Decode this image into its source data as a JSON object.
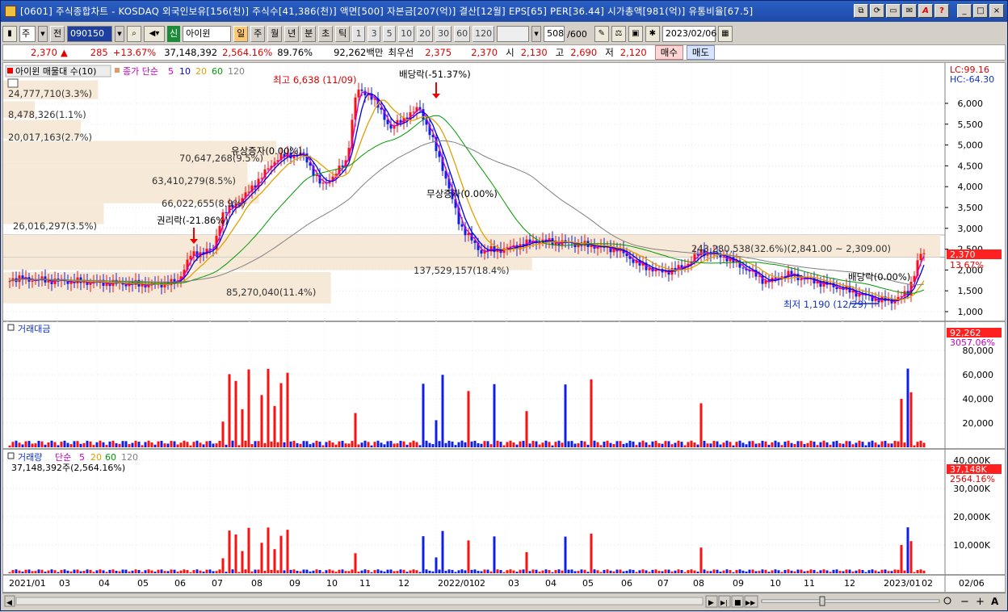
{
  "window": {
    "title": "[0601] 주식종합차트 - KOSDAQ 외국인보유[156(천)] 주식수[41,386(천)] 액면[500] 자본금[207(억)] 결산[12월] EPS[65] PER[36.44] 시가총액[981(억)] 유통비율[67.5]",
    "controls": [
      "⧉",
      "⟳",
      "▭",
      "✉",
      "A",
      "?",
      "_",
      "□",
      "×"
    ]
  },
  "toolbar": {
    "period_type": "주",
    "prev_label": "전",
    "stock_code": "090150",
    "new_tag": "신",
    "stock_name": "아이윈",
    "intervals": [
      "일",
      "주",
      "월",
      "년",
      "분",
      "초",
      "틱"
    ],
    "minute_options": [
      "1",
      "3",
      "5",
      "10",
      "20",
      "30",
      "60",
      "120"
    ],
    "count_value": "508",
    "count_total": "/600",
    "date": "2023/02/06"
  },
  "infobar": {
    "price": "2,370",
    "change_arrow": "▲",
    "change": "285",
    "change_pct": "+13.67%",
    "volume": "37,148,392",
    "volume_pct": "2,564.16%",
    "ratio": "89.76%",
    "amount": "92,262백만",
    "best_label": "최우선",
    "best_ask": "2,375",
    "best_bid": "2,370",
    "open_label": "시",
    "open": "2,130",
    "high_label": "고",
    "high": "2,690",
    "low_label": "저",
    "low": "2,120",
    "buy_label": "매수",
    "sell_label": "매도"
  },
  "price_panel": {
    "legend_stock": "아이윈 매물대 수(10)",
    "legend_ma": "종가 단순",
    "ma_periods": [
      "5",
      "10",
      "20",
      "60",
      "120"
    ],
    "ma_colors": {
      "5": "#cc00cc",
      "10": "#0000dd",
      "20": "#e0a000",
      "60": "#009900",
      "120": "#808080"
    },
    "lc": "LC:99.16",
    "hc": "HC:-64.30",
    "price_axis": [
      "6,000",
      "5,500",
      "5,000",
      "4,500",
      "4,000",
      "3,500",
      "3,000",
      "2,500",
      "2,000",
      "1,500",
      "1,000"
    ],
    "current_price_tag": "2,370",
    "current_pct_tag": "13.67%",
    "volume_profile": [
      {
        "label": "24,777,710(3.3%)",
        "share": 3.3
      },
      {
        "label": "8,478,326(1.1%)",
        "share": 1.1
      },
      {
        "label": "20,017,163(2.7%)",
        "share": 2.7
      },
      {
        "label": "70,647,268(9.5%)",
        "share": 9.5
      },
      {
        "label": "63,410,279(8.5%)",
        "share": 8.5
      },
      {
        "label": "66,022,655(8.9%)",
        "share": 8.9
      },
      {
        "label": "26,016,297(3.5%)",
        "share": 3.5
      },
      {
        "label": "243,280,538(32.6%)(2,841.00 ~ 2,309.00)",
        "share": 32.6
      },
      {
        "label": "137,529,157(18.4%)",
        "share": 18.4
      },
      {
        "label": "85,270,040(11.4%)",
        "share": 11.4
      }
    ],
    "annotations": {
      "high": "최고 6,638 (11/09)",
      "dividend1": "배당락(-51.37%)",
      "rights1": "유상증자(0.00%)",
      "rights2": "무상증자(0.00%)",
      "rights_drop": "권리락(-21.86%)",
      "low": "최저 1,190 (12/29)",
      "dividend2": "배당락(0.00%)"
    }
  },
  "amount_panel": {
    "title": "거래대금",
    "axis": [
      "80,000",
      "60,000",
      "40,000",
      "20,000"
    ],
    "last_tag": "92,262",
    "last_pct_tag": "3057.06%"
  },
  "volume_panel": {
    "title": "거래량",
    "legend_ma": "단순",
    "ma_periods": [
      "5",
      "20",
      "60",
      "120"
    ],
    "summary": "37,148,392주(2,564.16%)",
    "axis": [
      "40,000K",
      "30,000K",
      "20,000K",
      "10,000K"
    ],
    "last_tag": "37,148K",
    "last_pct_tag": "2564.16%"
  },
  "x_axis": [
    "2021/01",
    "03",
    "04",
    "05",
    "06",
    "07",
    "08",
    "09",
    "10",
    "11",
    "12",
    "2022/01",
    "02",
    "03",
    "04",
    "05",
    "06",
    "07",
    "08",
    "09",
    "10",
    "11",
    "12",
    "2023/01",
    "02",
    "02/06"
  ],
  "bottombar": {
    "nav": [
      "▶",
      "▶|",
      "■",
      "▶▶"
    ],
    "zoom": [
      "−",
      "+",
      "A"
    ]
  }
}
